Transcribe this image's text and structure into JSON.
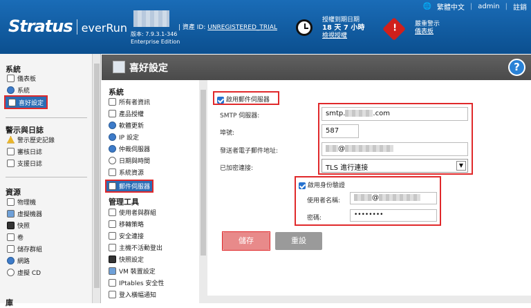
{
  "header": {
    "brand": "Stratus",
    "product": "everRun",
    "version_line1": "版本: 7.9.3.1-346",
    "version_line2": "Enterprise Edition",
    "asset_label": "| 資產 ID: ",
    "asset_value": "UNREGISTERED_TRIAL",
    "license_title": "授權到期日期",
    "license_days": "18 天 7 小時",
    "license_link": "檢視授權",
    "alert_title": "嚴重警示",
    "alert_link": "儀表板",
    "language": "繁體中文",
    "user": "admin",
    "logout": "註銷"
  },
  "leftnav": {
    "system_title": "系統",
    "system_items": [
      "儀表板",
      "系統",
      "喜好設定"
    ],
    "alerts_title": "警示與日誌",
    "alerts_items": [
      "警示歷史記錄",
      "審核日誌",
      "支援日誌"
    ],
    "resources_title": "資源",
    "resources_items": [
      "物理機",
      "虛擬機器",
      "快照",
      "卷",
      "儲存群組",
      "網路",
      "虛擬 CD"
    ],
    "cut_title": "庫"
  },
  "page": {
    "title": "喜好設定"
  },
  "midnav": {
    "system_title": "系統",
    "system_items": [
      "所有者資訊",
      "產品授權",
      "軟體更新",
      "IP 設定",
      "仲裁伺服器",
      "日期與時間",
      "系統資源",
      "郵件伺服器"
    ],
    "admin_title": "管理工具",
    "admin_items": [
      "使用者與群組",
      "移轉策略",
      "安全連接",
      "主機不活動登出",
      "快照設定",
      "VM 裝置設定",
      "IPtables 安全性",
      "登入橫幅通知"
    ]
  },
  "form": {
    "enable_mail_label": "啟用郵件伺服器",
    "smtp_label": "SMTP 伺服器:",
    "smtp_prefix": "smtp.",
    "smtp_suffix": ".com",
    "port_label": "埠號:",
    "port_value": "587",
    "sender_label": "發送者電子郵件地址:",
    "sender_at": "@",
    "encryption_label": "已加密連接:",
    "encryption_value": "TLS 進行連接",
    "enable_auth_label": "啟用身份驗證",
    "username_label": "使用者名稱:",
    "username_at": "@",
    "password_label": "密碼:",
    "password_value": "••••••••",
    "save_label": "儲存",
    "reset_label": "重設"
  },
  "colors": {
    "header_blue": "#0b4f8f",
    "highlight_red": "#e0282a",
    "save_button": "#e88a8a",
    "reset_button": "#9a9a9a"
  }
}
